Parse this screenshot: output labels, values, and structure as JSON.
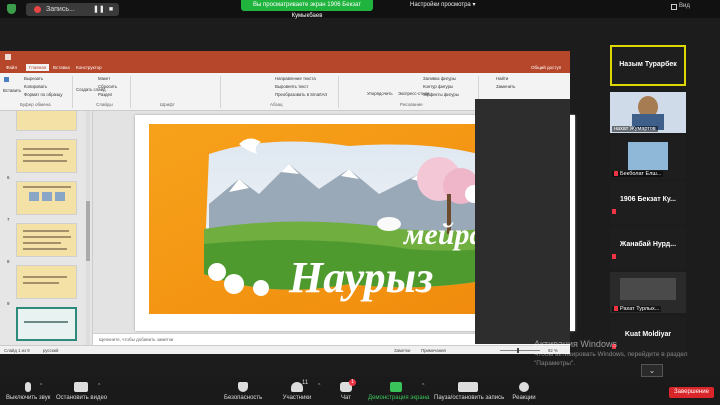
{
  "topbar": {
    "recording_label": "Запись...",
    "share_banner": "Вы просматриваете экран 1906 Бекзат Кумыкбаев",
    "view_settings": "Настройки просмотра",
    "view_mode": "Вид"
  },
  "ppt": {
    "tabs": [
      "Файл",
      "Главная",
      "Вставка",
      "Конструктор"
    ],
    "ribbon_right": [
      "Найти",
      "Заменить",
      "Общий доступ"
    ],
    "buttons": {
      "paste": "Вставить",
      "cut": "Вырезать",
      "copy": "Копировать",
      "format": "Формат по образцу",
      "create_slide": "Создать слайд",
      "layout": "Макет",
      "reset": "Сбросить",
      "section": "Раздел",
      "arrange": "Упорядочить",
      "express": "Экспресс-стили",
      "fill": "Заливка фигуры",
      "outline": "Контур фигуры",
      "effects": "Эффекты фигуры",
      "text_dir": "Направление текста",
      "align_text": "Выровнять текст",
      "smartart": "Преобразовать в SmartArt"
    },
    "groups": [
      "Буфер обмена",
      "Слайды",
      "Шрифт",
      "Абзац",
      "Рисование"
    ],
    "slide_numbers": [
      "6",
      "7",
      "8",
      "9"
    ],
    "notes_placeholder": "Щелкните, чтобы добавить заметки",
    "status": {
      "slide_info": "Слайд 1 из 9",
      "language": "русский",
      "notes": "Заметки",
      "comments": "Примечания",
      "zoom": "82 %"
    },
    "slide_title_line1": "мейрамы!",
    "slide_title_line2": "Наурыз"
  },
  "participants": [
    {
      "name": "Назым Турарбек",
      "type": "name",
      "active_speaker": true
    },
    {
      "name": "нахат Жумартов",
      "type": "video"
    },
    {
      "name": "Бекболат Елш...",
      "type": "video"
    },
    {
      "name": "1906 Бекзат Ку...",
      "type": "name",
      "muted": true
    },
    {
      "name": "Жанабай Нурд...",
      "type": "name",
      "muted": true
    },
    {
      "name": "Рахат Турлых...",
      "type": "video"
    },
    {
      "name": "Kuat Moldiyar",
      "type": "name",
      "muted": true
    }
  ],
  "watermark": {
    "title": "Активация Windows",
    "subtitle": "Чтобы активировать Windows, перейдите в раздел \"Параметры\"."
  },
  "toolbar": {
    "mute": "Выключить звук",
    "video": "Остановить видео",
    "security": "Безопасность",
    "participants": "Участники",
    "participants_count": "11",
    "chat": "Чат",
    "chat_badge": "1",
    "share": "Демонстрация экрана",
    "pause_record": "Пауза/остановить запись",
    "reactions": "Реакции",
    "end": "Завершение"
  },
  "colors": {
    "share_green": "#20b43f",
    "ppt_red": "#b7472a",
    "speaker_yellow": "#ddd700",
    "end_red": "#d9262b",
    "slide_orange": "#f39c12"
  }
}
